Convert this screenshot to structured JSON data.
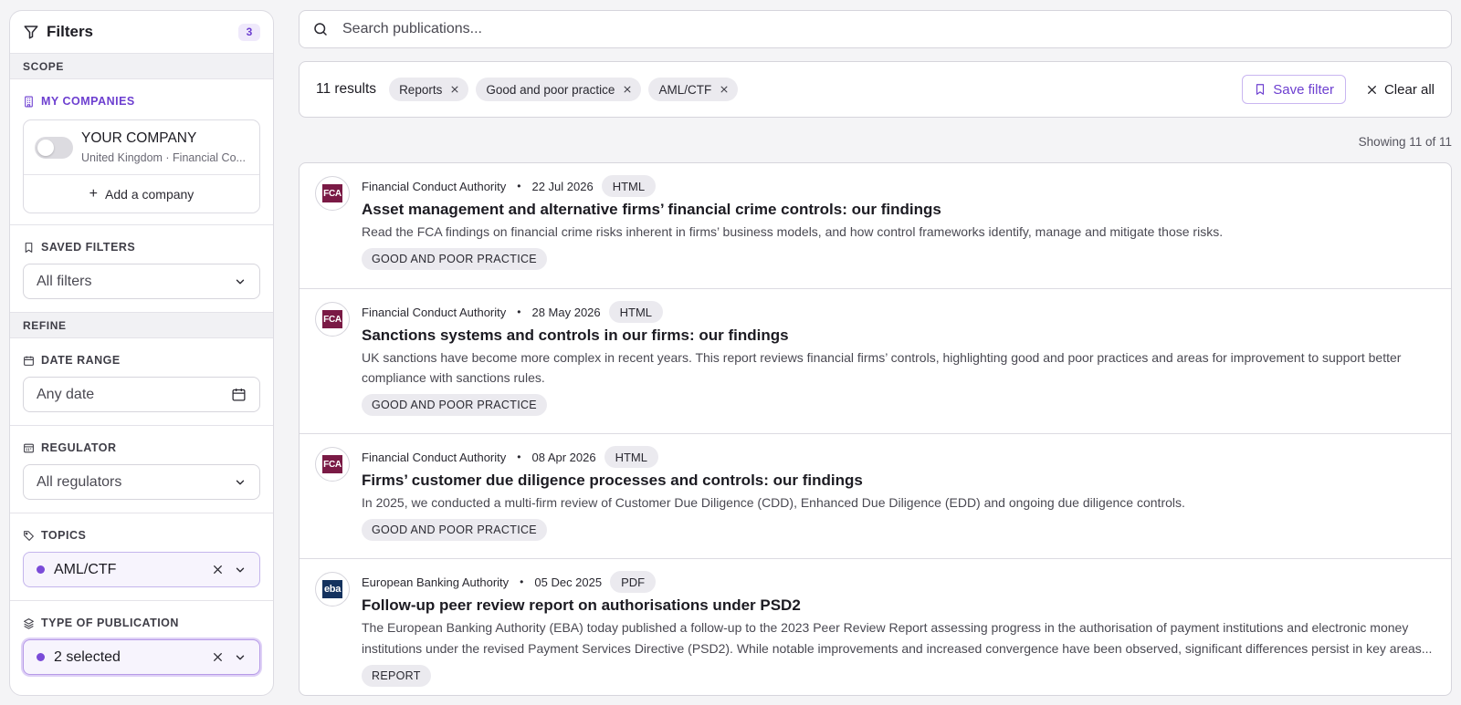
{
  "sidebar": {
    "title": "Filters",
    "count": "3",
    "scope_label": "SCOPE",
    "my_companies_label": "MY COMPANIES",
    "company": {
      "name": "YOUR COMPANY",
      "subtitle": "United Kingdom · Financial Co..."
    },
    "add_company_label": "Add a company",
    "saved_filters_label": "SAVED FILTERS",
    "saved_filters_value": "All filters",
    "refine_label": "REFINE",
    "date_range_label": "DATE RANGE",
    "date_range_value": "Any date",
    "regulator_label": "REGULATOR",
    "regulator_value": "All regulators",
    "topics_label": "TOPICS",
    "topics_value": "AML/CTF",
    "type_label": "TYPE OF PUBLICATION",
    "type_value": "2 selected"
  },
  "search": {
    "placeholder": "Search publications..."
  },
  "toolbar": {
    "results": "11 results",
    "chips": [
      "Reports",
      "Good and poor practice",
      "AML/CTF"
    ],
    "save_filter": "Save filter",
    "clear_all": "Clear all"
  },
  "showing": "Showing 11 of 11",
  "publications": [
    {
      "logo": "FCA",
      "source": "Financial Conduct Authority",
      "date": "22 Jul 2026",
      "format": "HTML",
      "title": "Asset management and alternative firms’ financial crime controls: our findings",
      "description": "Read the FCA findings on financial crime risks inherent in firms’ business models, and how control frameworks identify, manage and mitigate those risks.",
      "tag": "GOOD AND POOR PRACTICE"
    },
    {
      "logo": "FCA",
      "source": "Financial Conduct Authority",
      "date": "28 May 2026",
      "format": "HTML",
      "title": "Sanctions systems and controls in our firms: our findings",
      "description": "UK sanctions have become more complex in recent years. This report reviews financial firms’ controls, highlighting good and poor practices and areas for improvement to support better compliance with sanctions rules.",
      "tag": "GOOD AND POOR PRACTICE"
    },
    {
      "logo": "FCA",
      "source": "Financial Conduct Authority",
      "date": "08 Apr 2026",
      "format": "HTML",
      "title": "Firms’ customer due diligence processes and controls: our findings",
      "description": "In 2025, we conducted a multi-firm review of Customer Due Diligence (CDD), Enhanced Due Diligence (EDD) and ongoing due diligence controls.",
      "tag": "GOOD AND POOR PRACTICE"
    },
    {
      "logo": "eba",
      "source": "European Banking Authority",
      "date": "05 Dec 2025",
      "format": "PDF",
      "title": "Follow-up peer review report on authorisations under PSD2",
      "description": "The European Banking Authority (EBA) today published a follow-up to the 2023 Peer Review Report assessing progress in the authorisation of payment institutions and electronic money",
      "description_2": "institutions under the revised Payment Services Directive (PSD2). While notable improvements and increased convergence have been observed, significant differences persist in key areas...",
      "tag": "REPORT"
    }
  ]
}
